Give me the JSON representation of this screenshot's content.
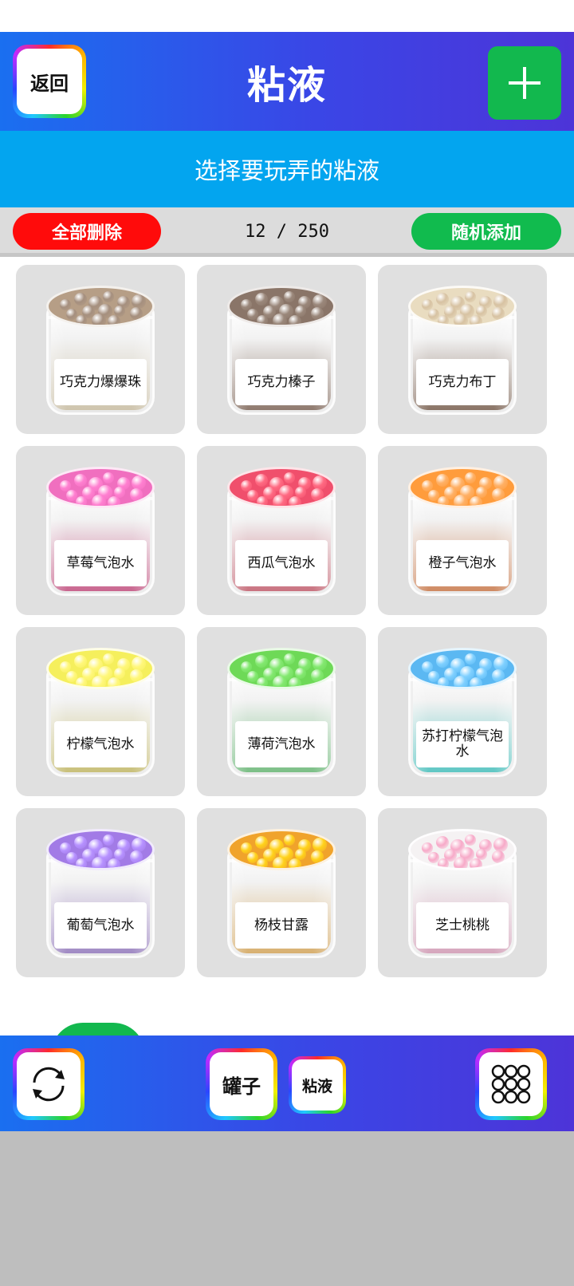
{
  "header": {
    "back_label": "返回",
    "title": "粘液",
    "add_icon": "plus-icon",
    "accent": "#12b84e"
  },
  "subtitle": "选择要玩弄的粘液",
  "controls": {
    "delete_all_label": "全部删除",
    "count": "12 / 250",
    "random_add_label": "随机添加"
  },
  "slimes": [
    {
      "name": "巧克力爆爆珠",
      "top": "#b69e86",
      "beads": "#a58f7e",
      "fill": "#cfc5ae"
    },
    {
      "name": "巧克力榛子",
      "top": "#8a7568",
      "beads": "#9a877a",
      "fill": "#8f7a6e"
    },
    {
      "name": "巧克力布丁",
      "top": "#e9dcc0",
      "beads": "#d7c2a2",
      "fill": "#8a7466"
    },
    {
      "name": "草莓气泡水",
      "top": "#f06fbf",
      "beads": "#ff7fd0",
      "fill": "#c9668f"
    },
    {
      "name": "西瓜气泡水",
      "top": "#f04f6c",
      "beads": "#ff6a82",
      "fill": "#c97380"
    },
    {
      "name": "橙子气泡水",
      "top": "#ff9c3c",
      "beads": "#ffb065",
      "fill": "#cf8a62"
    },
    {
      "name": "柠檬气泡水",
      "top": "#f5ef5c",
      "beads": "#fff77a",
      "fill": "#c9c07a"
    },
    {
      "name": "薄荷汽泡水",
      "top": "#6ed957",
      "beads": "#83e870",
      "fill": "#7bbf86"
    },
    {
      "name": "苏打柠檬气泡水",
      "top": "#5bb8f2",
      "beads": "#7fd0ff",
      "fill": "#5fc7c4"
    },
    {
      "name": "葡萄气泡水",
      "top": "#a27be6",
      "beads": "#b691ff",
      "fill": "#a08ac4"
    },
    {
      "name": "杨枝甘露",
      "top": "#f0a32b",
      "beads": "#ffd21a",
      "fill": "#d8b070"
    },
    {
      "name": "芝士桃桃",
      "top": "#f5f2f3",
      "beads": "#f7a9c8",
      "fill": "#d6a6bd"
    }
  ],
  "footer": {
    "refresh_icon": "refresh-icon",
    "jar_tab_label": "罐子",
    "slime_tab_label": "粘液",
    "grid_icon": "grid-icon"
  }
}
